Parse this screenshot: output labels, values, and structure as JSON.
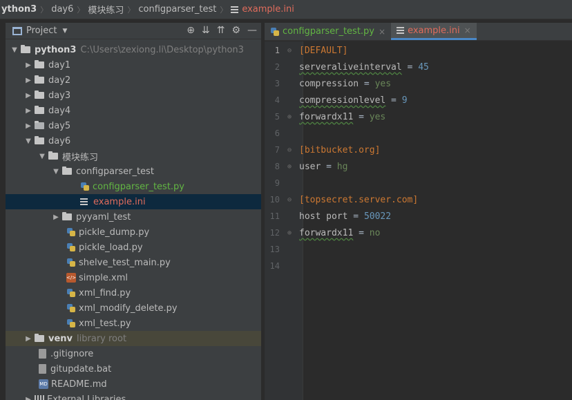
{
  "breadcrumb": {
    "items": [
      "ython3",
      "day6",
      "模块练习",
      "configparser_test",
      "example.ini"
    ]
  },
  "project": {
    "title": "Project",
    "root_name": "python3",
    "root_path": "C:\\Users\\zexiong.li\\Desktop\\python3",
    "tree": [
      {
        "label": "day1"
      },
      {
        "label": "day2"
      },
      {
        "label": "day3"
      },
      {
        "label": "day4"
      },
      {
        "label": "day5"
      },
      {
        "label": "day6"
      },
      {
        "label": "模块练习"
      },
      {
        "label": "configparser_test"
      },
      {
        "label": "configparser_test.py"
      },
      {
        "label": "example.ini"
      },
      {
        "label": "pyyaml_test"
      },
      {
        "label": "pickle_dump.py"
      },
      {
        "label": "pickle_load.py"
      },
      {
        "label": "shelve_test_main.py"
      },
      {
        "label": "simple.xml"
      },
      {
        "label": "xml_find.py"
      },
      {
        "label": "xml_modify_delete.py"
      },
      {
        "label": "xml_test.py"
      },
      {
        "label": "venv",
        "hint": "library root"
      },
      {
        "label": ".gitignore"
      },
      {
        "label": "gitupdate.bat"
      },
      {
        "label": "README.md"
      },
      {
        "label": "External Libraries"
      }
    ]
  },
  "tabs": [
    {
      "label": "configparser_test.py",
      "close": "×"
    },
    {
      "label": "example.ini",
      "close": "×"
    }
  ],
  "editor": {
    "line_numbers": [
      "1",
      "2",
      "3",
      "4",
      "5",
      "6",
      "7",
      "8",
      "9",
      "10",
      "11",
      "12",
      "13",
      "14"
    ],
    "lines": [
      {
        "section": "[DEFAULT]"
      },
      {
        "key": "serveraliveinterval",
        "eq": " = ",
        "num": "45"
      },
      {
        "key": "compression",
        "eq": " = ",
        "val": "yes"
      },
      {
        "key": "compressionlevel",
        "eq": " = ",
        "num": "9"
      },
      {
        "key": "forwardx11",
        "eq": " = ",
        "val": "yes"
      },
      {},
      {
        "section": "[bitbucket.org]"
      },
      {
        "key": "user",
        "eq": " = ",
        "val": "hg"
      },
      {},
      {
        "section": "[topsecret.server.com]"
      },
      {
        "key": "host port",
        "eq": " = ",
        "num": "50022"
      },
      {
        "key": "forwardx11",
        "eq": " = ",
        "val": "no"
      },
      {},
      {}
    ]
  },
  "colors": {
    "accent": "#4a88c7",
    "active_file": "#e06c5c",
    "section": "#cc7832",
    "number": "#6897bb",
    "string": "#6a8759"
  }
}
